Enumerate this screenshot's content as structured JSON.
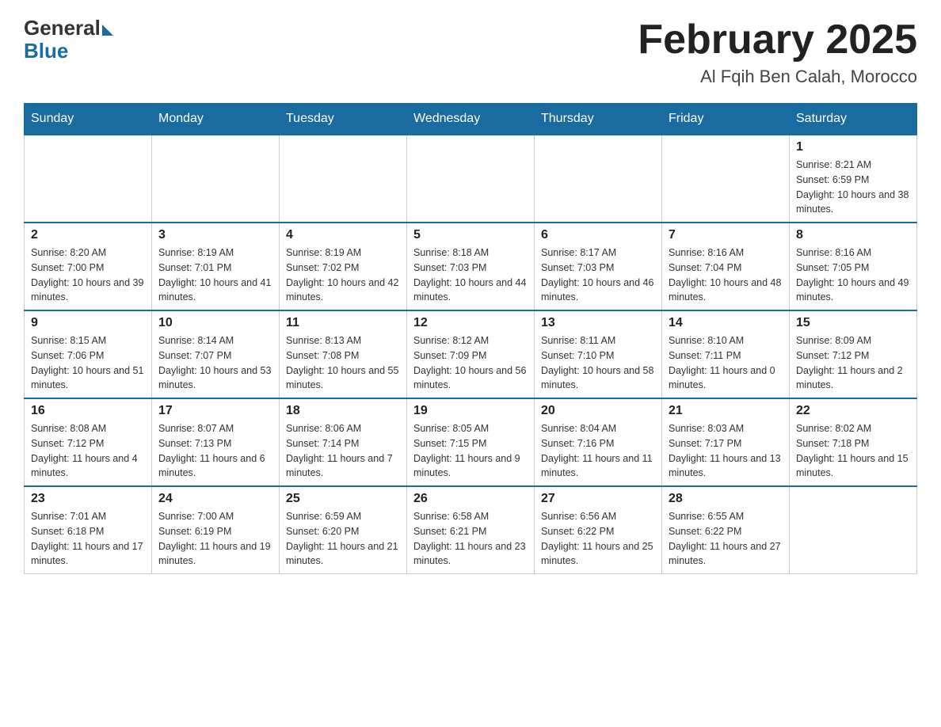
{
  "header": {
    "logo_general": "General",
    "logo_blue": "Blue",
    "month_title": "February 2025",
    "location": "Al Fqih Ben Calah, Morocco"
  },
  "days_of_week": [
    "Sunday",
    "Monday",
    "Tuesday",
    "Wednesday",
    "Thursday",
    "Friday",
    "Saturday"
  ],
  "weeks": [
    [
      {
        "day": "",
        "info": ""
      },
      {
        "day": "",
        "info": ""
      },
      {
        "day": "",
        "info": ""
      },
      {
        "day": "",
        "info": ""
      },
      {
        "day": "",
        "info": ""
      },
      {
        "day": "",
        "info": ""
      },
      {
        "day": "1",
        "info": "Sunrise: 8:21 AM\nSunset: 6:59 PM\nDaylight: 10 hours and 38 minutes."
      }
    ],
    [
      {
        "day": "2",
        "info": "Sunrise: 8:20 AM\nSunset: 7:00 PM\nDaylight: 10 hours and 39 minutes."
      },
      {
        "day": "3",
        "info": "Sunrise: 8:19 AM\nSunset: 7:01 PM\nDaylight: 10 hours and 41 minutes."
      },
      {
        "day": "4",
        "info": "Sunrise: 8:19 AM\nSunset: 7:02 PM\nDaylight: 10 hours and 42 minutes."
      },
      {
        "day": "5",
        "info": "Sunrise: 8:18 AM\nSunset: 7:03 PM\nDaylight: 10 hours and 44 minutes."
      },
      {
        "day": "6",
        "info": "Sunrise: 8:17 AM\nSunset: 7:03 PM\nDaylight: 10 hours and 46 minutes."
      },
      {
        "day": "7",
        "info": "Sunrise: 8:16 AM\nSunset: 7:04 PM\nDaylight: 10 hours and 48 minutes."
      },
      {
        "day": "8",
        "info": "Sunrise: 8:16 AM\nSunset: 7:05 PM\nDaylight: 10 hours and 49 minutes."
      }
    ],
    [
      {
        "day": "9",
        "info": "Sunrise: 8:15 AM\nSunset: 7:06 PM\nDaylight: 10 hours and 51 minutes."
      },
      {
        "day": "10",
        "info": "Sunrise: 8:14 AM\nSunset: 7:07 PM\nDaylight: 10 hours and 53 minutes."
      },
      {
        "day": "11",
        "info": "Sunrise: 8:13 AM\nSunset: 7:08 PM\nDaylight: 10 hours and 55 minutes."
      },
      {
        "day": "12",
        "info": "Sunrise: 8:12 AM\nSunset: 7:09 PM\nDaylight: 10 hours and 56 minutes."
      },
      {
        "day": "13",
        "info": "Sunrise: 8:11 AM\nSunset: 7:10 PM\nDaylight: 10 hours and 58 minutes."
      },
      {
        "day": "14",
        "info": "Sunrise: 8:10 AM\nSunset: 7:11 PM\nDaylight: 11 hours and 0 minutes."
      },
      {
        "day": "15",
        "info": "Sunrise: 8:09 AM\nSunset: 7:12 PM\nDaylight: 11 hours and 2 minutes."
      }
    ],
    [
      {
        "day": "16",
        "info": "Sunrise: 8:08 AM\nSunset: 7:12 PM\nDaylight: 11 hours and 4 minutes."
      },
      {
        "day": "17",
        "info": "Sunrise: 8:07 AM\nSunset: 7:13 PM\nDaylight: 11 hours and 6 minutes."
      },
      {
        "day": "18",
        "info": "Sunrise: 8:06 AM\nSunset: 7:14 PM\nDaylight: 11 hours and 7 minutes."
      },
      {
        "day": "19",
        "info": "Sunrise: 8:05 AM\nSunset: 7:15 PM\nDaylight: 11 hours and 9 minutes."
      },
      {
        "day": "20",
        "info": "Sunrise: 8:04 AM\nSunset: 7:16 PM\nDaylight: 11 hours and 11 minutes."
      },
      {
        "day": "21",
        "info": "Sunrise: 8:03 AM\nSunset: 7:17 PM\nDaylight: 11 hours and 13 minutes."
      },
      {
        "day": "22",
        "info": "Sunrise: 8:02 AM\nSunset: 7:18 PM\nDaylight: 11 hours and 15 minutes."
      }
    ],
    [
      {
        "day": "23",
        "info": "Sunrise: 7:01 AM\nSunset: 6:18 PM\nDaylight: 11 hours and 17 minutes."
      },
      {
        "day": "24",
        "info": "Sunrise: 7:00 AM\nSunset: 6:19 PM\nDaylight: 11 hours and 19 minutes."
      },
      {
        "day": "25",
        "info": "Sunrise: 6:59 AM\nSunset: 6:20 PM\nDaylight: 11 hours and 21 minutes."
      },
      {
        "day": "26",
        "info": "Sunrise: 6:58 AM\nSunset: 6:21 PM\nDaylight: 11 hours and 23 minutes."
      },
      {
        "day": "27",
        "info": "Sunrise: 6:56 AM\nSunset: 6:22 PM\nDaylight: 11 hours and 25 minutes."
      },
      {
        "day": "28",
        "info": "Sunrise: 6:55 AM\nSunset: 6:22 PM\nDaylight: 11 hours and 27 minutes."
      },
      {
        "day": "",
        "info": ""
      }
    ]
  ]
}
